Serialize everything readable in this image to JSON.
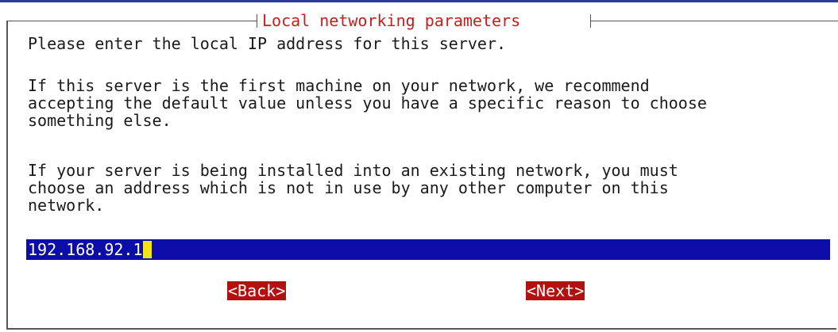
{
  "dialog": {
    "title": "Local networking parameters",
    "paragraph_1": "Please enter the local IP address for this server.",
    "paragraph_2": "If this server is the first machine on your network, we recommend\naccepting the default value unless you have a specific reason to choose\nsomething else.",
    "paragraph_3": "If your server is being installed into an existing network, you must\nchoose an address which is not in use by any other computer on this\nnetwork.",
    "ip_input": {
      "value": "192.168.92.1"
    },
    "buttons": {
      "back_label": "<Back>",
      "next_label": "<Next>"
    }
  },
  "colors": {
    "title_text": "#c81d1d",
    "input_background": "#0c0ca8",
    "cursor": "#f4e41a",
    "button_background": "#b31010",
    "top_bar": "#2b3a9a"
  }
}
